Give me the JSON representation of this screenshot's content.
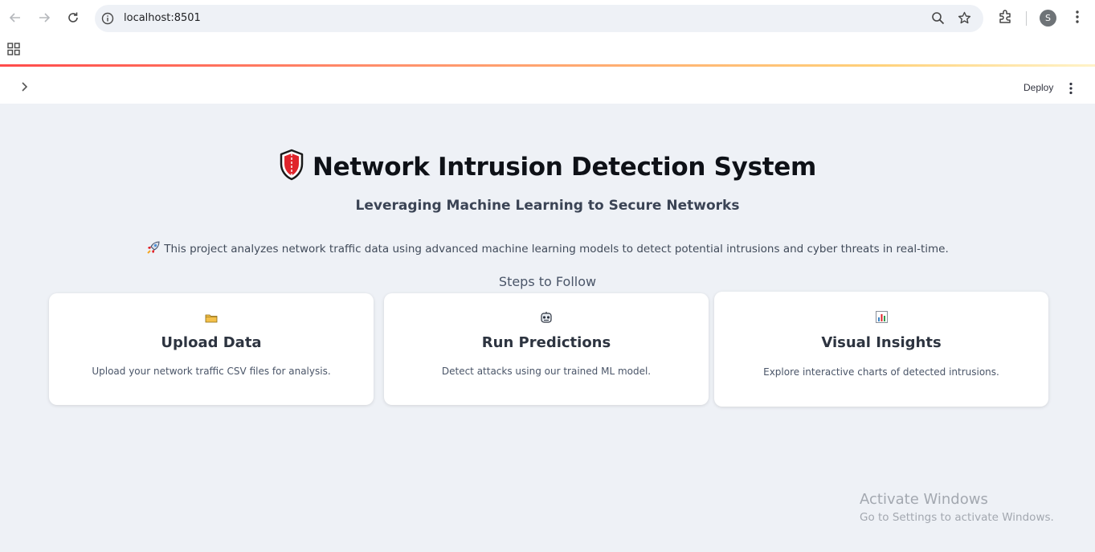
{
  "browser": {
    "url": "localhost:8501",
    "profile_initial": "S"
  },
  "app_header": {
    "deploy_label": "Deploy"
  },
  "main": {
    "title": "Network Intrusion Detection System",
    "subtitle": "Leveraging Machine Learning to Secure Networks",
    "description": "This project analyzes network traffic data using advanced machine learning models to detect potential intrusions and cyber threats in real-time.",
    "steps_heading": "Steps to Follow",
    "cards": [
      {
        "icon": "folder-icon",
        "title": "Upload Data",
        "text": "Upload your network traffic CSV files for analysis."
      },
      {
        "icon": "robot-icon",
        "title": "Run Predictions",
        "text": "Detect attacks using our trained ML model."
      },
      {
        "icon": "bar-chart-icon",
        "title": "Visual Insights",
        "text": "Explore interactive charts of detected intrusions."
      }
    ]
  },
  "watermark": {
    "line1": "Activate Windows",
    "line2": "Go to Settings to activate Windows."
  },
  "colors": {
    "accent_line_start": "#ff4b4b",
    "page_bg": "#eef1f6",
    "title": "#0e1117"
  }
}
